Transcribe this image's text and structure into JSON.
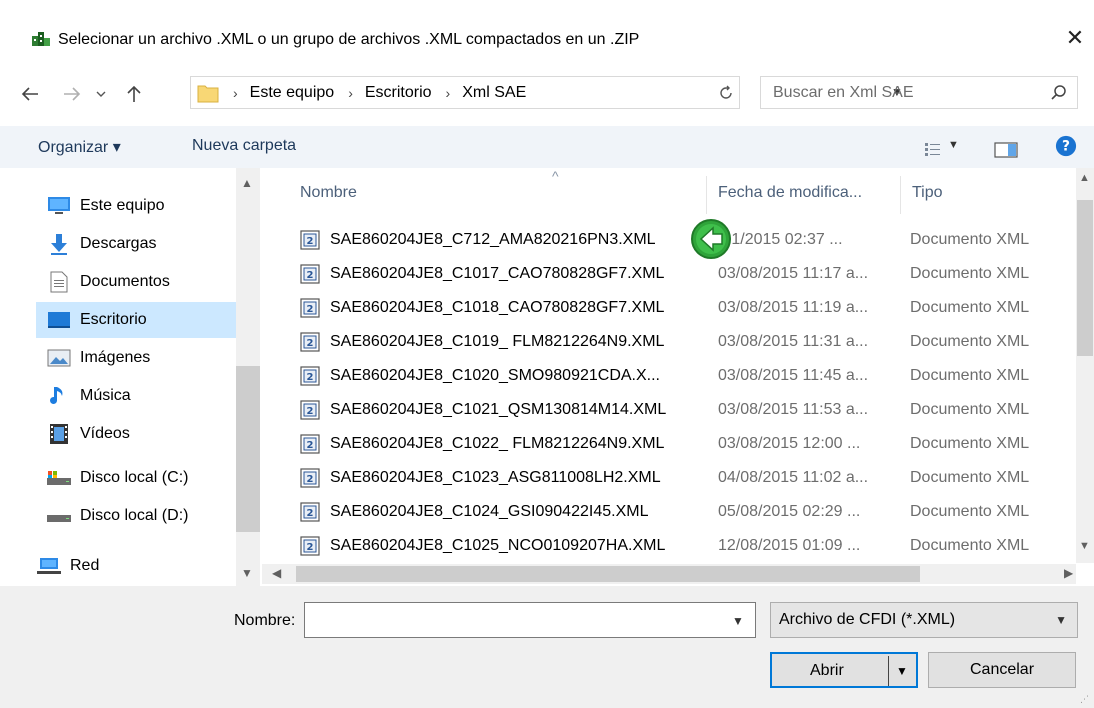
{
  "window": {
    "title": "Selecionar un archivo .XML o un grupo de archivos .XML compactados en un .ZIP",
    "close_glyph": "✕"
  },
  "nav": {
    "back_icon": "arrow-left-icon",
    "forward_icon": "arrow-right-icon",
    "recent_icon": "chevron-down-icon",
    "up_icon": "arrow-up-icon",
    "breadcrumbs": [
      "Este equipo",
      "Escritorio",
      "Xml SAE"
    ],
    "search_placeholder": "Buscar en Xml SAE"
  },
  "toolbar": {
    "organize_label": "Organizar ▾",
    "new_folder_label": "Nueva carpeta"
  },
  "sidebar": {
    "items": [
      {
        "label": "Este equipo",
        "icon": "computer-icon"
      },
      {
        "label": "Descargas",
        "icon": "download-icon"
      },
      {
        "label": "Documentos",
        "icon": "document-icon"
      },
      {
        "label": "Escritorio",
        "icon": "desktop-icon",
        "selected": true
      },
      {
        "label": "Imágenes",
        "icon": "images-icon"
      },
      {
        "label": "Música",
        "icon": "music-icon"
      },
      {
        "label": "Vídeos",
        "icon": "video-icon"
      },
      {
        "label": "Disco local (C:)",
        "icon": "drive-c-icon"
      },
      {
        "label": "Disco local (D:)",
        "icon": "drive-icon"
      },
      {
        "label": "Red",
        "icon": "network-icon"
      }
    ]
  },
  "columns": {
    "name": "Nombre",
    "date": "Fecha de modifica...",
    "type": "Tipo"
  },
  "files": [
    {
      "name": "SAE860204JE8_C712_AMA820216PN3.XML",
      "date": "/01/2015 02:37 ...",
      "type": "Documento XML"
    },
    {
      "name": "SAE860204JE8_C1017_CAO780828GF7.XML",
      "date": "03/08/2015 11:17 a...",
      "type": "Documento XML"
    },
    {
      "name": "SAE860204JE8_C1018_CAO780828GF7.XML",
      "date": "03/08/2015 11:19 a...",
      "type": "Documento XML"
    },
    {
      "name": "SAE860204JE8_C1019_ FLM8212264N9.XML",
      "date": "03/08/2015 11:31 a...",
      "type": "Documento XML"
    },
    {
      "name": "SAE860204JE8_C1020_SMO980921CDA.X...",
      "date": "03/08/2015 11:45 a...",
      "type": "Documento XML"
    },
    {
      "name": "SAE860204JE8_C1021_QSM130814M14.XML",
      "date": "03/08/2015 11:53 a...",
      "type": "Documento XML"
    },
    {
      "name": "SAE860204JE8_C1022_ FLM8212264N9.XML",
      "date": "03/08/2015 12:00 ...",
      "type": "Documento XML"
    },
    {
      "name": "SAE860204JE8_C1023_ASG811008LH2.XML",
      "date": "04/08/2015 11:02 a...",
      "type": "Documento XML"
    },
    {
      "name": "SAE860204JE8_C1024_GSI090422I45.XML",
      "date": "05/08/2015 02:29 ...",
      "type": "Documento XML"
    },
    {
      "name": "SAE860204JE8_C1025_NCO0109207HA.XML",
      "date": "12/08/2015 01:09 ...",
      "type": "Documento XML"
    }
  ],
  "footer": {
    "name_label": "Nombre:",
    "name_value": "",
    "filter_value": "Archivo de CFDI (*.XML)",
    "open_label": "Abrir",
    "cancel_label": "Cancelar"
  },
  "colors": {
    "toolbar_bg": "#f0f4f9",
    "selected_bg": "#cce8ff",
    "accent": "#0078d7"
  }
}
